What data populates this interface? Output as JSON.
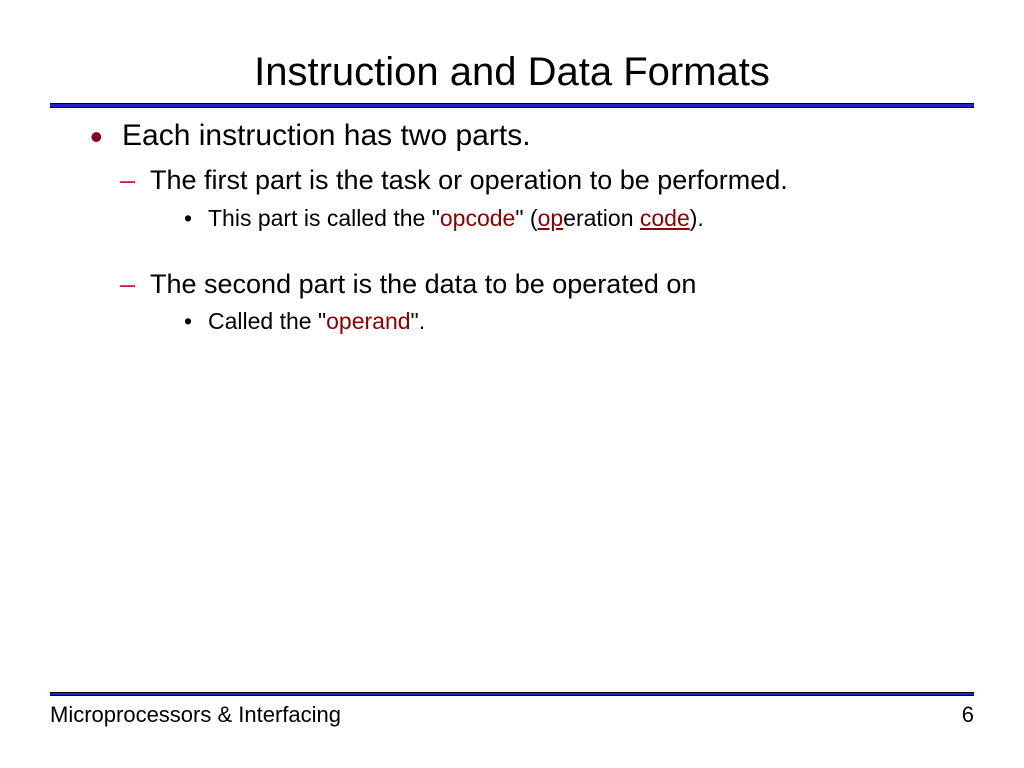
{
  "title": "Instruction and Data Formats",
  "content": {
    "l1_a": "Each instruction has two parts.",
    "l2_a": "The first part is the task or operation to be performed.",
    "l3_a_pre": "This part is called the \"",
    "l3_a_em1": "opcode",
    "l3_a_mid": "\" (",
    "l3_a_u1": "op",
    "l3_a_txt1": "eration ",
    "l3_a_u2": "code",
    "l3_a_post": ").",
    "l2_b": "The second part is the data to be operated on",
    "l3_b_pre": "Called the \"",
    "l3_b_em1": "operand",
    "l3_b_post": "\"."
  },
  "footer": {
    "left": "Microprocessors & Interfacing",
    "page": "6"
  }
}
